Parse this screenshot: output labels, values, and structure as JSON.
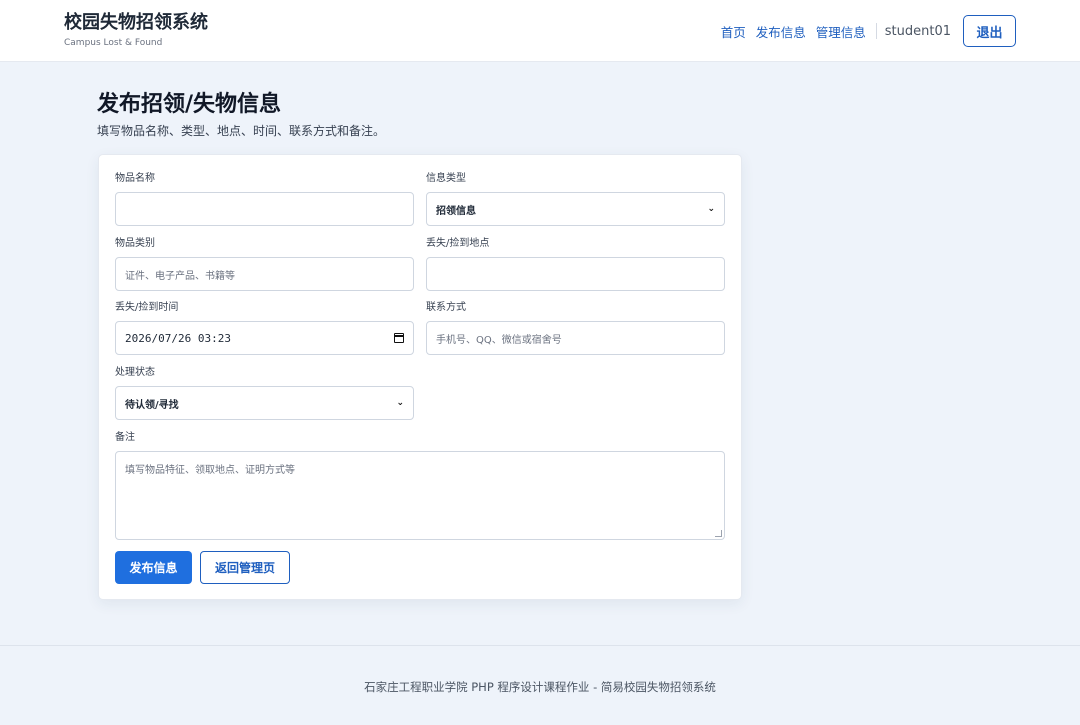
{
  "header": {
    "title": "校园失物招领系统",
    "subtitle": "Campus Lost & Found",
    "nav": [
      "首页",
      "发布信息",
      "管理信息"
    ],
    "username": "student01",
    "logout_label": "退出"
  },
  "page": {
    "title": "发布招领/失物信息",
    "description": "填写物品名称、类型、地点、时间、联系方式和备注。"
  },
  "form": {
    "item_name": {
      "label": "物品名称",
      "value": ""
    },
    "info_type": {
      "label": "信息类型",
      "value": "招领信息"
    },
    "category": {
      "label": "物品类别",
      "placeholder": "证件、电子产品、书籍等"
    },
    "location": {
      "label": "丢失/捡到地点",
      "value": ""
    },
    "time": {
      "label": "丢失/捡到时间",
      "value": "2026/07/26 03:23"
    },
    "contact": {
      "label": "联系方式",
      "placeholder": "手机号、QQ、微信或宿舍号"
    },
    "status": {
      "label": "处理状态",
      "value": "待认领/寻找"
    },
    "remark": {
      "label": "备注",
      "placeholder": "填写物品特征、领取地点、证明方式等"
    },
    "submit_label": "发布信息",
    "back_label": "返回管理页"
  },
  "footer": {
    "text": "石家庄工程职业学院 PHP 程序设计课程作业 - 简易校园失物招领系统"
  },
  "icons": {
    "select_arrow": "chevron-down-icon",
    "date_picker": "calendar-icon"
  },
  "colors": {
    "primary": "#1f6fdf",
    "link": "#1f5fbf",
    "background": "#eef3fa"
  }
}
